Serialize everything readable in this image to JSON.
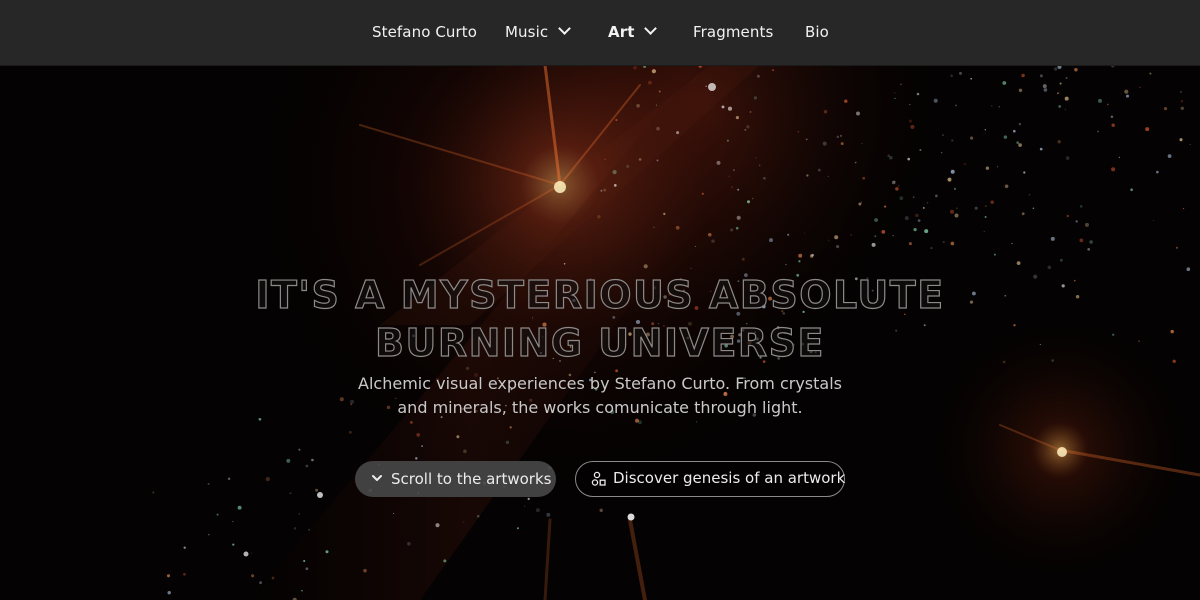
{
  "nav": {
    "items": [
      {
        "label": "Stefano Curto",
        "has_dropdown": false,
        "active": false
      },
      {
        "label": "Music",
        "has_dropdown": true,
        "active": false
      },
      {
        "label": "Art",
        "has_dropdown": true,
        "active": true
      },
      {
        "label": "Fragments",
        "has_dropdown": false,
        "active": false
      },
      {
        "label": "Bio",
        "has_dropdown": false,
        "active": false
      }
    ],
    "chevron_icon": "chevron-down-icon"
  },
  "hero": {
    "headline_line1": "IT'S A MYSTERIOUS ABSOLUTE",
    "headline_line2": "BURNING UNIVERSE",
    "subtitle_line1": "Alchemic visual experiences by Stefano Curto. From crystals",
    "subtitle_line2": "and minerals, the works comunicate through light.",
    "buttons": {
      "scroll_label": "Scroll to the artworks",
      "scroll_icon": "chevron-down-icon",
      "genesis_label": "Discover genesis of an artwork",
      "genesis_icon": "shapes-icon"
    },
    "background_image": "particle-light-burst"
  },
  "colors": {
    "nav_background": "#272727",
    "nav_text": "#f2f2f2",
    "page_background": "#050303",
    "accent_glow": "#ff8a3c",
    "headline_outline": "#8d8a88",
    "button_fill": "#464646",
    "button_border": "#8a8a8a"
  }
}
